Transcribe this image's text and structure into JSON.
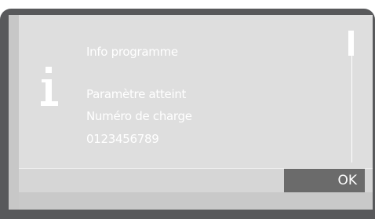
{
  "dialog": {
    "title": "Info programme",
    "lines": [
      "Paramètre atteint",
      "Numéro de charge",
      "0123456789"
    ],
    "icon": "info-icon"
  },
  "actions": {
    "ok_label": "OK"
  },
  "colors": {
    "bezel": "#58595b",
    "screen": "#d6d6d6",
    "text": "#ffffff",
    "button": "#6b6b6b"
  }
}
